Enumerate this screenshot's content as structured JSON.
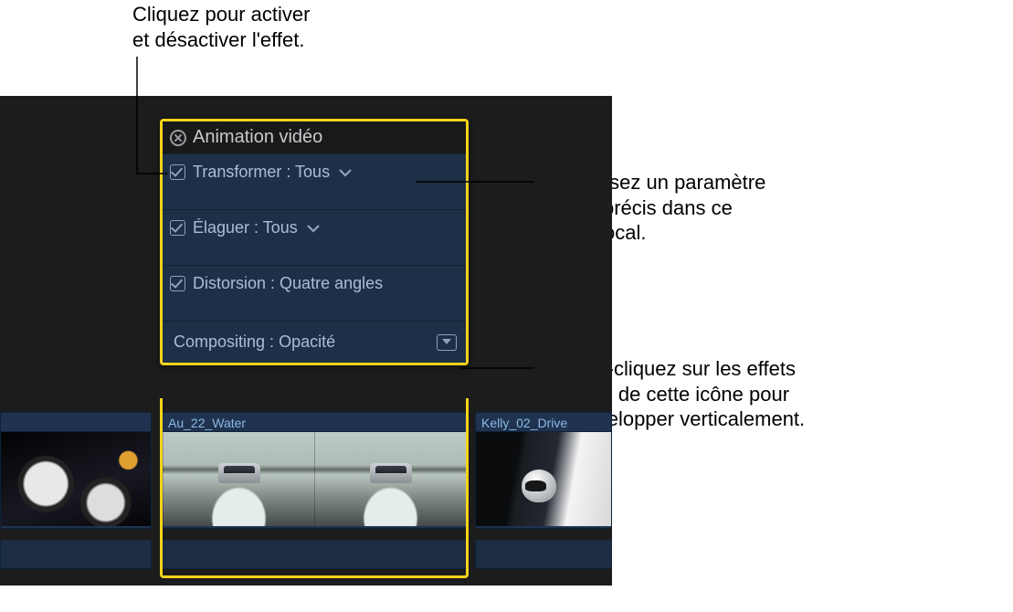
{
  "annotations": {
    "top": "Cliquez pour activer\net désactiver l'effet.",
    "right1": "Choisissez un paramètre\nd'effet précis dans ce\nmenu local.",
    "right2": "Double-cliquez sur les effets\nassortis de cette icône pour\nles développer verticalement."
  },
  "panel": {
    "title": "Animation vidéo",
    "effects": [
      {
        "name": "Transformer",
        "param": "Tous",
        "has_dropdown": true,
        "has_checkbox": true,
        "checked": true,
        "expandable": false
      },
      {
        "name": "Élaguer",
        "param": "Tous",
        "has_dropdown": true,
        "has_checkbox": true,
        "checked": true,
        "expandable": false
      },
      {
        "name": "Distorsion",
        "param": "Quatre angles",
        "has_dropdown": false,
        "has_checkbox": true,
        "checked": true,
        "expandable": false
      },
      {
        "name": "Compositing",
        "param": "Opacité",
        "has_dropdown": false,
        "has_checkbox": false,
        "checked": false,
        "expandable": true
      }
    ]
  },
  "clips": [
    {
      "title": "Au_22_Water"
    },
    {
      "title": "Kelly_02_Drive"
    }
  ],
  "labels": {
    "sep": " : "
  }
}
